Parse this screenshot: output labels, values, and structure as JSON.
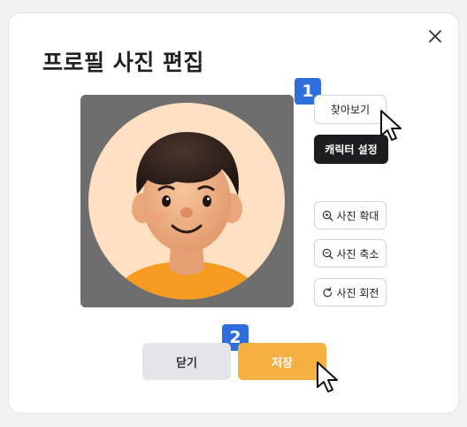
{
  "dialog": {
    "title": "프로필 사진 편집"
  },
  "actions": {
    "browse_label": "찾아보기",
    "character_label": "캐릭터 설정",
    "zoom_in_label": "사진 확대",
    "zoom_out_label": "사진 축소",
    "rotate_label": "사진 회전"
  },
  "footer": {
    "close_label": "닫기",
    "save_label": "저장"
  },
  "badges": {
    "first": "1",
    "second": "2"
  },
  "colors": {
    "save": "#f6b041",
    "badge": "#2f6fdc",
    "dark_button": "#1d1d1f",
    "photo_backdrop": "#6e6e6e"
  },
  "icons": {
    "close": "close-icon",
    "zoom_in": "zoom-in-icon",
    "zoom_out": "zoom-out-icon",
    "rotate": "rotate-icon",
    "cursor": "mouse-pointer-icon"
  }
}
